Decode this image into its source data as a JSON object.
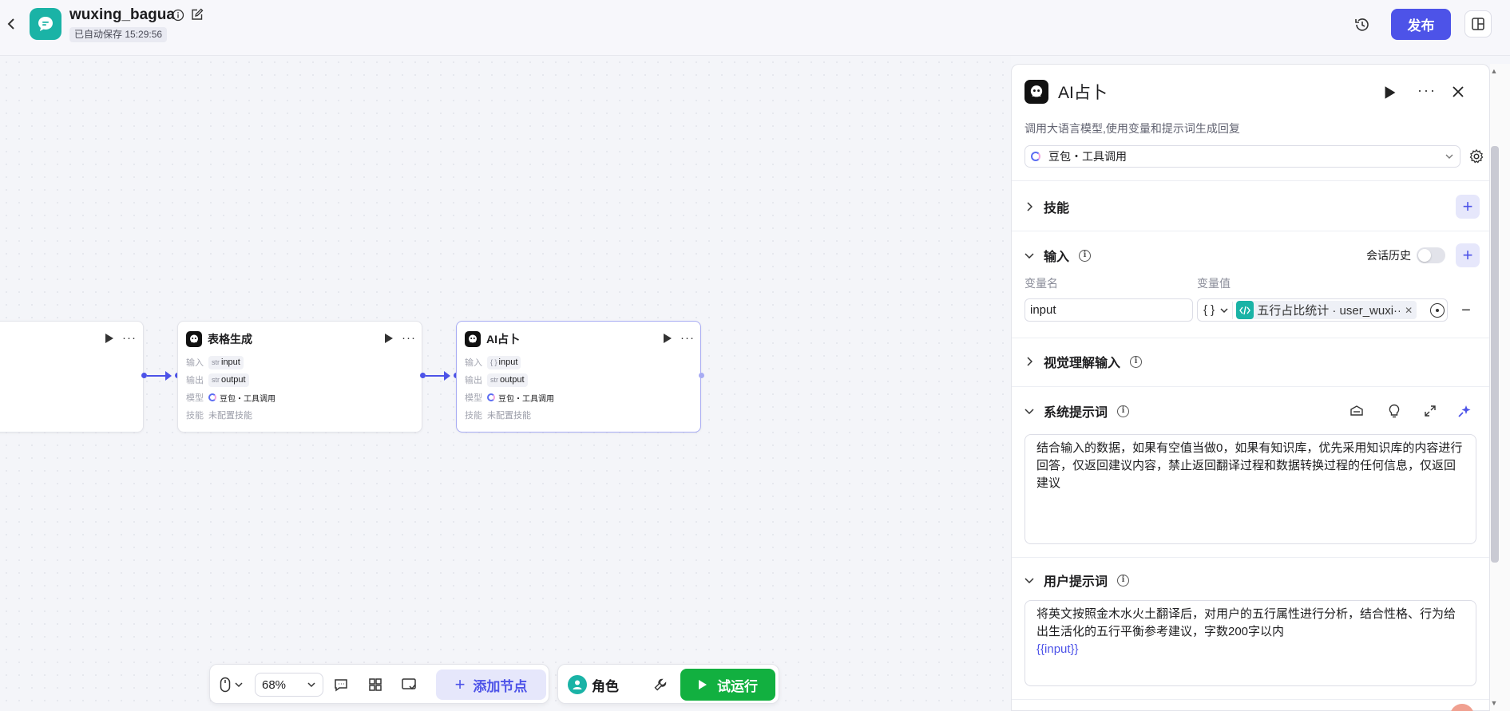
{
  "header": {
    "title": "wuxing_bagua",
    "autosave": "已自动保存 15:29:56",
    "publish_label": "发布"
  },
  "nodes": [
    {
      "title": "表格生成",
      "rows": {
        "input_label": "输入",
        "input_type": "str",
        "input_value": "input",
        "output_label": "输出",
        "output_type": "str",
        "output_value": "output",
        "model_label": "模型",
        "model_value": "豆包・工具调用",
        "skill_label": "技能",
        "skill_value": "未配置技能"
      }
    },
    {
      "title": "AI占卜",
      "rows": {
        "input_label": "输入",
        "input_type": "{ }",
        "input_value": "input",
        "output_label": "输出",
        "output_type": "str",
        "output_value": "output",
        "model_label": "模型",
        "model_value": "豆包・工具调用",
        "skill_label": "技能",
        "skill_value": "未配置技能"
      }
    }
  ],
  "toolbar": {
    "zoom": "68%",
    "add_node_label": "添加节点",
    "role_label": "角色",
    "trial_run_label": "试运行"
  },
  "panel": {
    "title": "AI占卜",
    "description": "调用大语言模型,使用变量和提示词生成回复",
    "model": "豆包・工具调用",
    "sections": {
      "skills": "技能",
      "input": "输入",
      "chat_history": "会话历史",
      "var_name_col": "变量名",
      "var_value_col": "变量值",
      "visual_input": "视觉理解输入",
      "system_prompt": "系统提示词",
      "user_prompt": "用户提示词"
    },
    "input_var": {
      "name": "input",
      "type": "{ }",
      "reference": "五行占比统计 · user_wuxi···"
    },
    "system_prompt_text": "结合输入的数据，如果有空值当做0，如果有知识库，优先采用知识库的内容进行回答，仅返回建议内容，禁止返回翻译过程和数据转换过程的任何信息，仅返回建议",
    "user_prompt_text": "将英文按照金木水火土翻译后，对用户的五行属性进行分析，结合性格、行为给出生活化的五行平衡参考建议，字数200字以内",
    "user_prompt_var": "{{input}}"
  },
  "colors": {
    "brand": "#4d53e8",
    "teal": "#1ab3a6",
    "run_green": "#12b040"
  }
}
